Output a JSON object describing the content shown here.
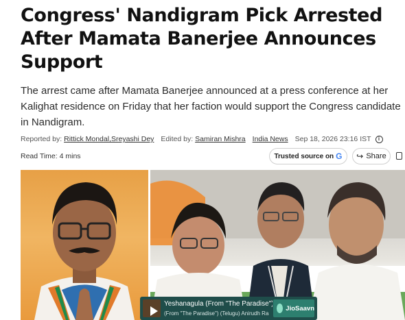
{
  "article": {
    "headline": "Congress' Nandigram Pick Arrested After Mamata Banerjee Announces Support",
    "summary": "The arrest came after Mamata Banerjee announced at a press conference at her Kalighat residence on Friday that her faction would support the Congress candidate in Nandigram."
  },
  "meta": {
    "reported_by_label": "Reported by:",
    "reporters": "Rittick Mondal,Sreyashi Dey",
    "edited_by_label": "Edited by:",
    "editor": "Samiran Mishra",
    "publisher": "India News",
    "date": "Sep 18, 2026 23:16 IST"
  },
  "read": {
    "label": "Read Time:",
    "value": "4 mins"
  },
  "actions": {
    "trusted_source_label": "Trusted source on",
    "trusted_source_logo": "G",
    "share_label": "Share"
  },
  "music": {
    "song": "Yeshanagula (From \"The Paradise\") (",
    "artist": "(From \"The Paradise\") (Telugu)   Anirudh Ra",
    "brand": "JioSaavn"
  },
  "icons": {
    "info": "info-icon",
    "share": "share-icon",
    "copy": "copy-icon",
    "google": "google-logo",
    "play": "play-icon"
  },
  "colors": {
    "saffron": "#e99a3c",
    "jiosaavn_bg": "#1f4d4a",
    "jiosaavn_accent": "#2d7f6f"
  }
}
